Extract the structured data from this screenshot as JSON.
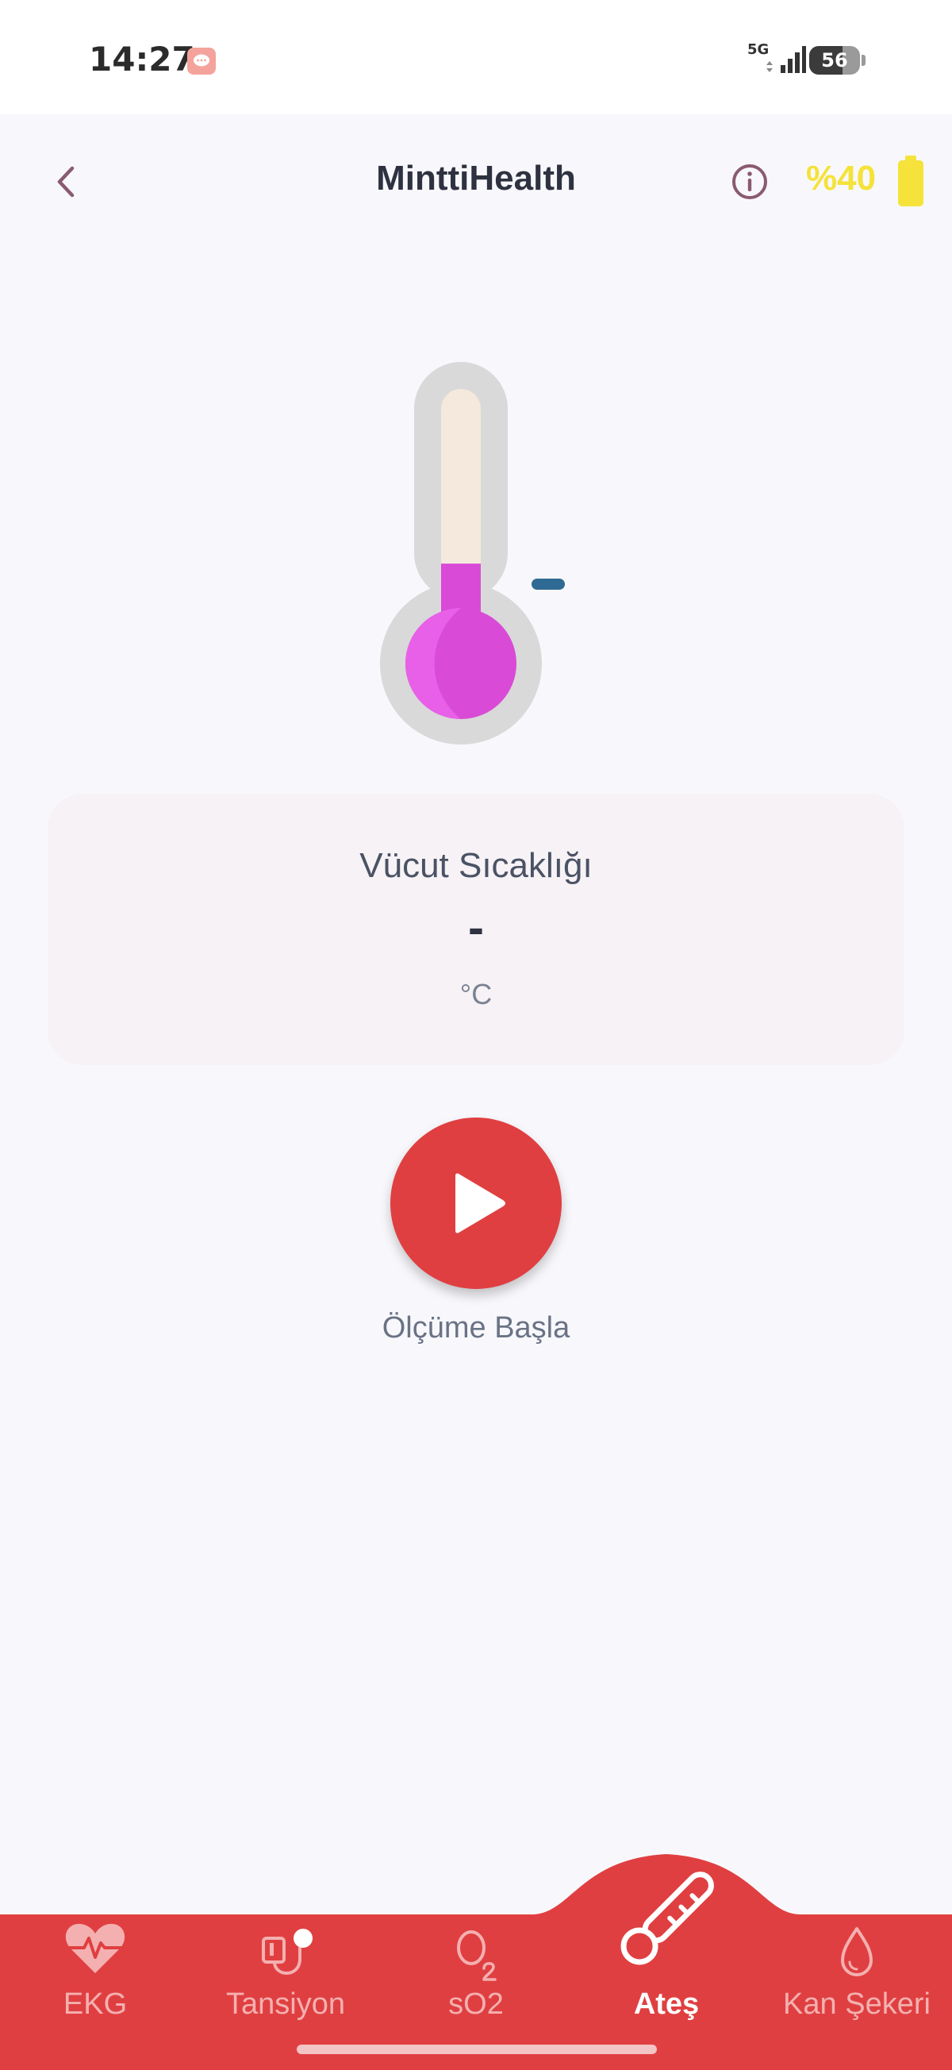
{
  "status_bar": {
    "time": "14:27",
    "network": "5G",
    "battery_level": "56",
    "icons": [
      "message-icon",
      "signal-icon",
      "battery-icon"
    ]
  },
  "header": {
    "title": "MinttiHealth",
    "device_battery": "%40",
    "icons": [
      "back-icon",
      "info-icon",
      "battery-icon"
    ],
    "colors": {
      "battery": "#f5e23a",
      "icon": "#8a5a70"
    }
  },
  "thermometer": {
    "fill_fraction": 0.29,
    "colors": {
      "fill": "#d94bd6",
      "tube": "#f4e9dc",
      "frame": "#d9d9d9",
      "marker": "#2f6a94"
    }
  },
  "reading": {
    "label": "Vücut Sıcaklığı",
    "value": "-",
    "unit": "°C"
  },
  "action": {
    "start_label": "Ölçüme Başla",
    "icon": "play-icon",
    "color": "#e03f41"
  },
  "bottom_nav": {
    "items": [
      {
        "label": "EKG",
        "icon": "heart-pulse-icon",
        "active": false
      },
      {
        "label": "Tansiyon",
        "icon": "blood-pressure-icon",
        "active": false
      },
      {
        "label": "sO2",
        "icon": "oxygen-icon",
        "active": false
      },
      {
        "label": "Ateş",
        "icon": "thermometer-icon",
        "active": true
      },
      {
        "label": "Kan Şekeri",
        "icon": "blood-drop-icon",
        "active": false
      }
    ],
    "colors": {
      "background": "#e03f41",
      "inactive": "#f4b0b0",
      "active": "#ffffff"
    }
  }
}
